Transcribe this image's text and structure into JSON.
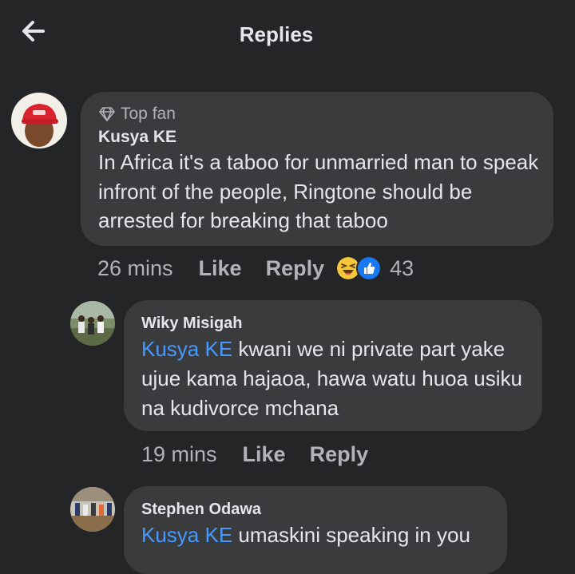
{
  "header": {
    "title": "Replies"
  },
  "comments": [
    {
      "badge": "Top fan",
      "author": "Kusya KE",
      "text": "In Africa it's a taboo for unmarried man to speak infront of the people, Ringtone should be arrested for breaking that taboo",
      "time": "26 mins",
      "like_label": "Like",
      "reply_label": "Reply",
      "reaction_count": "43"
    },
    {
      "author": "Wiky Misigah",
      "mention": "Kusya KE",
      "text": "kwani we ni private part yake ujue kama hajaoa, hawa watu huoa usiku na kudivorce mchana",
      "time": "19 mins",
      "like_label": "Like",
      "reply_label": "Reply"
    },
    {
      "author": "Stephen Odawa",
      "mention": "Kusya KE",
      "text": "umaskini speaking in you"
    }
  ],
  "colors": {
    "background": "#242526",
    "bubble": "#3a3b3c",
    "mention": "#4599ff",
    "muted": "#b0b3b8"
  },
  "icons": {
    "back": "arrow-left-icon",
    "badge": "diamond-icon",
    "reactions": [
      "haha-reaction-icon",
      "like-reaction-icon"
    ]
  }
}
